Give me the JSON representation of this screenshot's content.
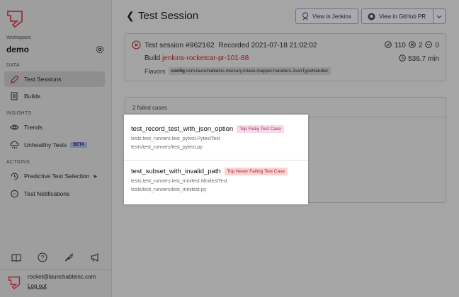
{
  "sidebar": {
    "workspace_label": "Workspace",
    "workspace_name": "demo",
    "sections": {
      "data": "DATA",
      "insights": "INSIGHTS",
      "actions": "ACTIONS"
    },
    "items": {
      "test_sessions": "Test Sessions",
      "builds": "Builds",
      "trends": "Trends",
      "unhealthy_tests": "Unhealthy Tests",
      "beta_badge": "BETA",
      "predictive": "Predictive Test Selection",
      "notifications": "Test Notifications"
    },
    "user_email": "rocket@launchableinc.com",
    "logout": "Log out"
  },
  "header": {
    "title": "Test Session",
    "jenkins_button": "View in Jenkins",
    "github_button": "View in GitHub PR"
  },
  "session": {
    "label": "Test session",
    "id": "#962162",
    "recorded": "Recorded 2021-07-18 21:02:02",
    "passed": "110",
    "failed": "2",
    "skipped": "0",
    "build_label": "Build",
    "build_name": "jenkins-rocketcar-pr-101-88",
    "duration": "536.7 min",
    "flavors_label": "Flavors",
    "flavor_key": "config",
    "flavor_value": "com.launchableinc.mercury.intake.mapper.handlers.JsonTypeHandler"
  },
  "failed": {
    "count_label": "2 failed cases",
    "cases": [
      {
        "name": "test_record_test_with_json_option",
        "tag": "Top Flaky Test Case",
        "class_path": "tests.test_runners.test_pytest.PytestTest",
        "file": "tests/test_runners/test_pytest.py"
      },
      {
        "name": "test_subset_with_invalid_path",
        "tag": "Top Never Failing Test Case",
        "class_path": "tests.test_runners.test_minitest.MinitestTest",
        "file": "tests/test_runners/test_minitest.py"
      }
    ]
  },
  "colors": {
    "accent": "#d6314e",
    "flaky_tag": "#f8d9e7",
    "fail_tag": "#f9d3d3"
  }
}
